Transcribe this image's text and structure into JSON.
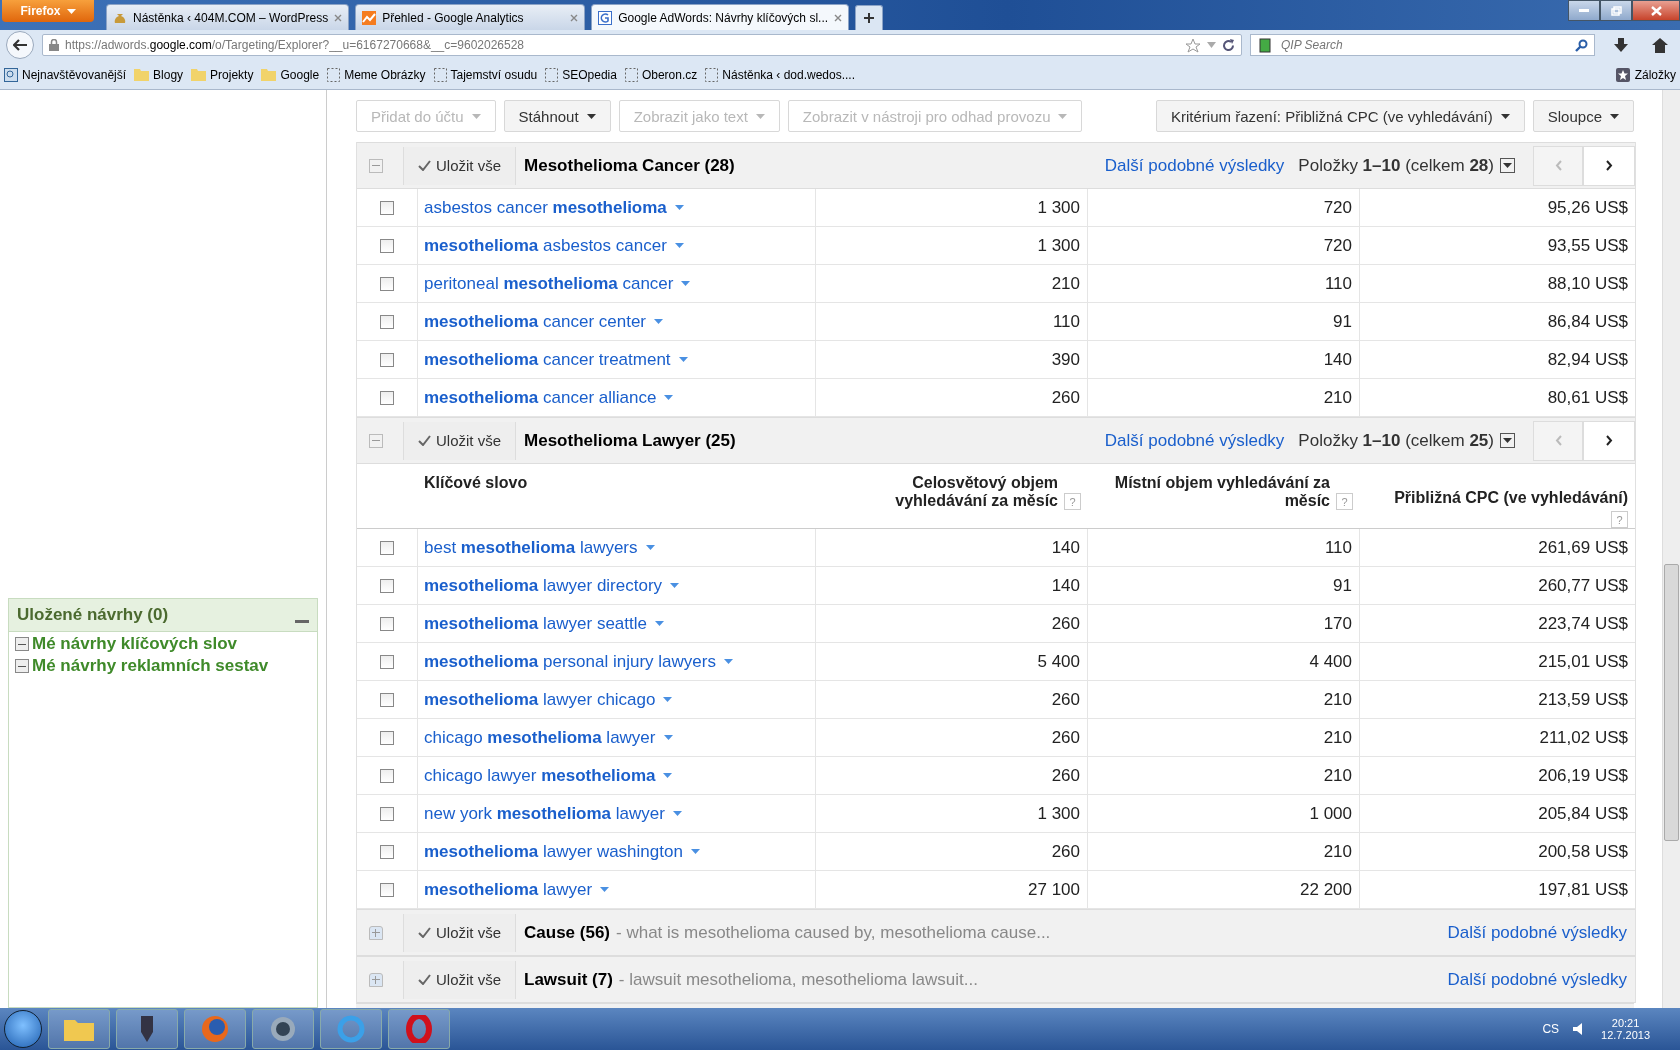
{
  "browser": {
    "menu_button": "Firefox",
    "tabs": [
      {
        "label": "Nástěnka ‹ 404M.COM – WordPress",
        "selected": false
      },
      {
        "label": "Přehled - Google Analytics",
        "selected": false
      },
      {
        "label": "Google AdWords: Návrhy klíčových sl...",
        "selected": true
      }
    ],
    "url": "https://adwords.**google.com**/o/Targeting/Explorer?__u=6167270668&__c=9602026528",
    "search": {
      "placeholder": "QIP Search"
    },
    "bookmarks": [
      {
        "label": "Nejnavštěvovanější",
        "kind": "smart"
      },
      {
        "label": "Blogy",
        "kind": "folder"
      },
      {
        "label": "Projekty",
        "kind": "folder"
      },
      {
        "label": "Google",
        "kind": "folder"
      },
      {
        "label": "Meme Obrázky",
        "kind": "page"
      },
      {
        "label": "Tajemství osudu",
        "kind": "page"
      },
      {
        "label": "SEOpedia",
        "kind": "page"
      },
      {
        "label": "Oberon.cz",
        "kind": "page"
      },
      {
        "label": "Nástěnka ‹ dod.wedos....",
        "kind": "page"
      }
    ],
    "bookmarks_menu": "Záložky"
  },
  "sidebar": {
    "title": "Uložené návrhy (0)",
    "items": [
      {
        "label": "Mé návrhy klíčových slov"
      },
      {
        "label": "Mé návrhy reklamních sestav"
      }
    ]
  },
  "toolbar": {
    "buttons": [
      {
        "label": "Přidat do účtu",
        "disabled": true
      },
      {
        "label": "Stáhnout",
        "disabled": false
      },
      {
        "label": "Zobrazit jako text",
        "disabled": true
      },
      {
        "label": "Zobrazit v nástroji pro odhad provozu",
        "disabled": true
      }
    ],
    "sort": "Kritérium řazení: Přibližná CPC (ve vyhledávání)",
    "columns": "Sloupce"
  },
  "groups": [
    {
      "title": "Mesothelioma Cancer (28)",
      "expanded": true,
      "save": "Uložit vše",
      "more": "Další podobné výsledky",
      "pager": "Položky **1–10** (celkem **28**)",
      "rows": [
        {
          "keyword": "asbestos cancer **mesothelioma**",
          "global": "1 300",
          "local": "720",
          "cpc": "95,26 US$",
          "checked": false
        },
        {
          "keyword": "**mesothelioma** asbestos cancer",
          "global": "1 300",
          "local": "720",
          "cpc": "93,55 US$",
          "checked": false
        },
        {
          "keyword": "peritoneal **mesothelioma** cancer",
          "global": "210",
          "local": "110",
          "cpc": "88,10 US$",
          "checked": false
        },
        {
          "keyword": "**mesothelioma** cancer center",
          "global": "110",
          "local": "91",
          "cpc": "86,84 US$",
          "checked": false
        },
        {
          "keyword": "**mesothelioma** cancer treatment",
          "global": "390",
          "local": "140",
          "cpc": "82,94 US$",
          "checked": false
        },
        {
          "keyword": "**mesothelioma** cancer alliance",
          "global": "260",
          "local": "210",
          "cpc": "80,61 US$",
          "checked": false
        }
      ]
    },
    {
      "title": "Mesothelioma Lawyer (25)",
      "expanded": true,
      "save": "Uložit vše",
      "more": "Další podobné výsledky",
      "pager": "Položky **1–10** (celkem **25**)",
      "columns": [
        {
          "label": "Klíčové slovo",
          "help": false
        },
        {
          "label": "Celosvětový objem vyhledávání za měsíc",
          "help": true
        },
        {
          "label": "Místní objem vyhledávání za měsíc",
          "help": true
        },
        {
          "label": "Přibližná CPC (ve vyhledávání)",
          "help": true
        }
      ],
      "help_mark": "?",
      "rows": [
        {
          "keyword": "best **mesothelioma** lawyers",
          "global": "140",
          "local": "110",
          "cpc": "261,69 US$",
          "checked": false
        },
        {
          "keyword": "**mesothelioma** lawyer directory",
          "global": "140",
          "local": "91",
          "cpc": "260,77 US$",
          "checked": false
        },
        {
          "keyword": "**mesothelioma** lawyer seattle",
          "global": "260",
          "local": "170",
          "cpc": "223,74 US$",
          "checked": false
        },
        {
          "keyword": "**mesothelioma** personal injury lawyers",
          "global": "5 400",
          "local": "4 400",
          "cpc": "215,01 US$",
          "checked": false
        },
        {
          "keyword": "**mesothelioma** lawyer chicago",
          "global": "260",
          "local": "210",
          "cpc": "213,59 US$",
          "checked": false
        },
        {
          "keyword": "chicago **mesothelioma** lawyer",
          "global": "260",
          "local": "210",
          "cpc": "211,02 US$",
          "checked": false
        },
        {
          "keyword": "chicago lawyer **mesothelioma**",
          "global": "260",
          "local": "210",
          "cpc": "206,19 US$",
          "checked": false
        },
        {
          "keyword": "new york **mesothelioma** lawyer",
          "global": "1 300",
          "local": "1 000",
          "cpc": "205,84 US$",
          "checked": false
        },
        {
          "keyword": "**mesothelioma** lawyer washington",
          "global": "260",
          "local": "210",
          "cpc": "200,58 US$",
          "checked": false
        },
        {
          "keyword": "**mesothelioma** lawyer",
          "global": "27 100",
          "local": "22 200",
          "cpc": "197,81 US$",
          "checked": false
        }
      ]
    },
    {
      "title": "Cause (56)",
      "expanded": false,
      "save": "Uložit vše",
      "more": "Další podobné výsledky",
      "summary": "- what is mesothelioma caused by, mesothelioma cause..."
    },
    {
      "title": "Lawsuit (7)",
      "expanded": false,
      "save": "Uložit vše",
      "more": "Další podobné výsledky",
      "summary": "- lawsuit mesothelioma, mesothelioma lawsuit..."
    }
  ],
  "taskbar": {
    "language": "CS",
    "time": "20:21",
    "date": "12.7.2013"
  }
}
